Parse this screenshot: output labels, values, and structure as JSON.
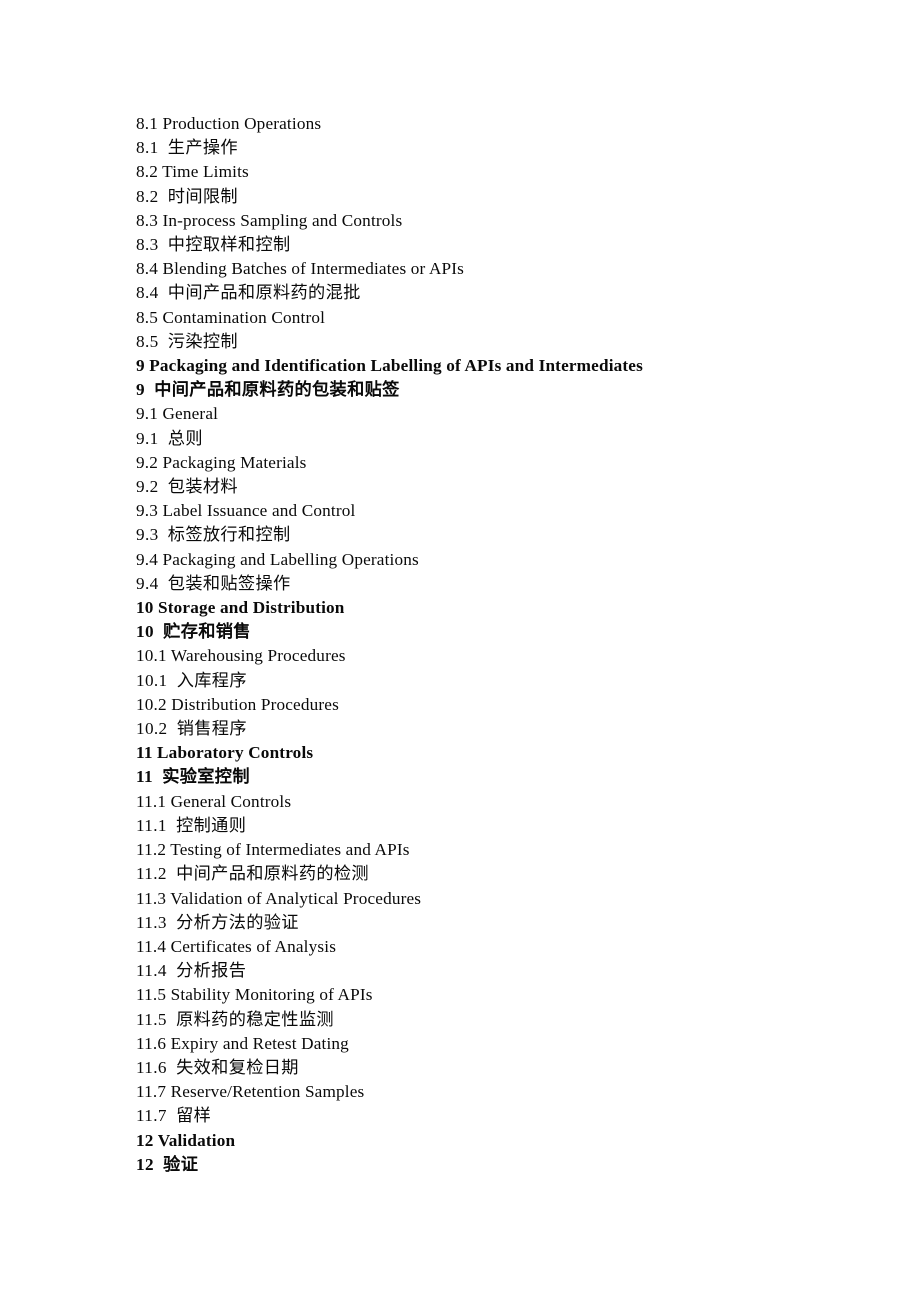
{
  "document": {
    "type": "table-of-contents",
    "language_pairs": "English line followed by Chinese translation line",
    "page_background": "#ffffff",
    "text_color": "#0a0a0a",
    "lines": [
      {
        "text": "8.1 Production Operations",
        "lang": "en",
        "bold": false
      },
      {
        "text": "8.1  生产操作",
        "lang": "zh",
        "bold": false
      },
      {
        "text": "8.2 Time Limits",
        "lang": "en",
        "bold": false
      },
      {
        "text": "8.2  时间限制",
        "lang": "zh",
        "bold": false
      },
      {
        "text": "8.3 In-process Sampling and Controls",
        "lang": "en",
        "bold": false
      },
      {
        "text": "8.3  中控取样和控制",
        "lang": "zh",
        "bold": false
      },
      {
        "text": "8.4 Blending Batches of Intermediates or APIs",
        "lang": "en",
        "bold": false
      },
      {
        "text": "8.4  中间产品和原料药的混批",
        "lang": "zh",
        "bold": false
      },
      {
        "text": "8.5 Contamination Control",
        "lang": "en",
        "bold": false
      },
      {
        "text": "8.5  污染控制",
        "lang": "zh",
        "bold": false
      },
      {
        "text": "9 Packaging and Identification Labelling of APIs and Intermediates",
        "lang": "en",
        "bold": true
      },
      {
        "text": "9  中间产品和原料药的包装和贴签",
        "lang": "zh",
        "bold": true
      },
      {
        "text": "9.1 General",
        "lang": "en",
        "bold": false
      },
      {
        "text": "9.1  总则",
        "lang": "zh",
        "bold": false
      },
      {
        "text": "9.2 Packaging Materials",
        "lang": "en",
        "bold": false
      },
      {
        "text": "9.2  包装材料",
        "lang": "zh",
        "bold": false
      },
      {
        "text": "9.3 Label Issuance and Control",
        "lang": "en",
        "bold": false
      },
      {
        "text": "9.3  标签放行和控制",
        "lang": "zh",
        "bold": false
      },
      {
        "text": "9.4 Packaging and Labelling Operations",
        "lang": "en",
        "bold": false
      },
      {
        "text": "9.4  包装和贴签操作",
        "lang": "zh",
        "bold": false
      },
      {
        "text": "10 Storage and Distribution",
        "lang": "en",
        "bold": true
      },
      {
        "text": "10  贮存和销售",
        "lang": "zh",
        "bold": true
      },
      {
        "text": "10.1 Warehousing Procedures",
        "lang": "en",
        "bold": false
      },
      {
        "text": "10.1  入库程序",
        "lang": "zh",
        "bold": false
      },
      {
        "text": "10.2 Distribution Procedures",
        "lang": "en",
        "bold": false
      },
      {
        "text": "10.2  销售程序",
        "lang": "zh",
        "bold": false
      },
      {
        "text": "11 Laboratory Controls",
        "lang": "en",
        "bold": true
      },
      {
        "text": "11  实验室控制",
        "lang": "zh",
        "bold": true
      },
      {
        "text": "11.1 General Controls",
        "lang": "en",
        "bold": false
      },
      {
        "text": "11.1  控制通则",
        "lang": "zh",
        "bold": false
      },
      {
        "text": "11.2 Testing of Intermediates and APIs",
        "lang": "en",
        "bold": false
      },
      {
        "text": "11.2  中间产品和原料药的检测",
        "lang": "zh",
        "bold": false
      },
      {
        "text": "11.3 Validation of Analytical Procedures",
        "lang": "en",
        "bold": false
      },
      {
        "text": "11.3  分析方法的验证",
        "lang": "zh",
        "bold": false
      },
      {
        "text": "11.4 Certificates of Analysis",
        "lang": "en",
        "bold": false
      },
      {
        "text": "11.4  分析报告",
        "lang": "zh",
        "bold": false
      },
      {
        "text": "11.5 Stability Monitoring of APIs",
        "lang": "en",
        "bold": false
      },
      {
        "text": "11.5  原料药的稳定性监测",
        "lang": "zh",
        "bold": false
      },
      {
        "text": "11.6 Expiry and Retest Dating",
        "lang": "en",
        "bold": false
      },
      {
        "text": "11.6  失效和复检日期",
        "lang": "zh",
        "bold": false
      },
      {
        "text": "11.7 Reserve/Retention Samples",
        "lang": "en",
        "bold": false
      },
      {
        "text": "11.7  留样",
        "lang": "zh",
        "bold": false
      },
      {
        "text": "12 Validation",
        "lang": "en",
        "bold": true
      },
      {
        "text": "12  验证",
        "lang": "zh",
        "bold": true
      }
    ]
  }
}
